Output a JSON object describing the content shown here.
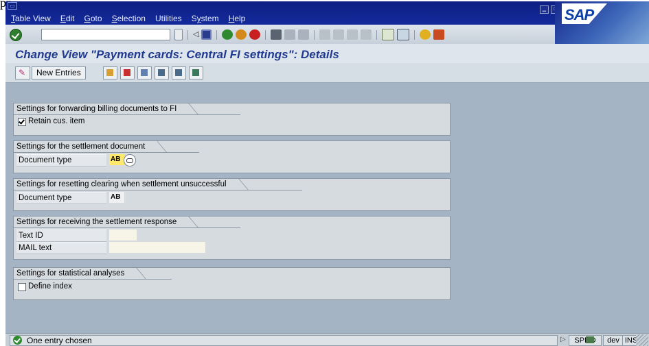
{
  "app_label": "pp",
  "menu": [
    "Table View",
    "Edit",
    "Goto",
    "Selection",
    "Utilities",
    "System",
    "Help"
  ],
  "menu_underline": [
    "T",
    "E",
    "G",
    "S",
    "",
    "y",
    "H"
  ],
  "logo_text": "SAP",
  "page_title": "Change View \"Payment cards: Central FI settings\": Details",
  "app_toolbar": {
    "new_entries": "New Entries"
  },
  "groups": {
    "forwarding": {
      "title": "Settings for forwarding billing documents to FI",
      "checkbox_label": "Retain cus. item",
      "checked": true
    },
    "settlement": {
      "title": "Settings for the settlement document",
      "label": "Document type",
      "value": "AB"
    },
    "resetting": {
      "title": "Settings for resetting clearing when settlement unsuccessful",
      "label": "Document type",
      "value": "AB"
    },
    "response": {
      "title": "Settings for receiving the settlement response",
      "text_id_label": "Text ID",
      "text_id_value": "",
      "mail_text_label": "MAIL text",
      "mail_text_value": ""
    },
    "statistical": {
      "title": "Settings for statistical analyses",
      "checkbox_label": "Define index",
      "checked": false
    }
  },
  "status": {
    "message": "One entry chosen",
    "transaction": "SPRO",
    "system": "dev",
    "mode": "INS"
  },
  "colors": {
    "menubar": "#0c1f82",
    "background": "#a4b4c4",
    "title": "#1f3a8f",
    "required_field": "#ffe86a"
  }
}
